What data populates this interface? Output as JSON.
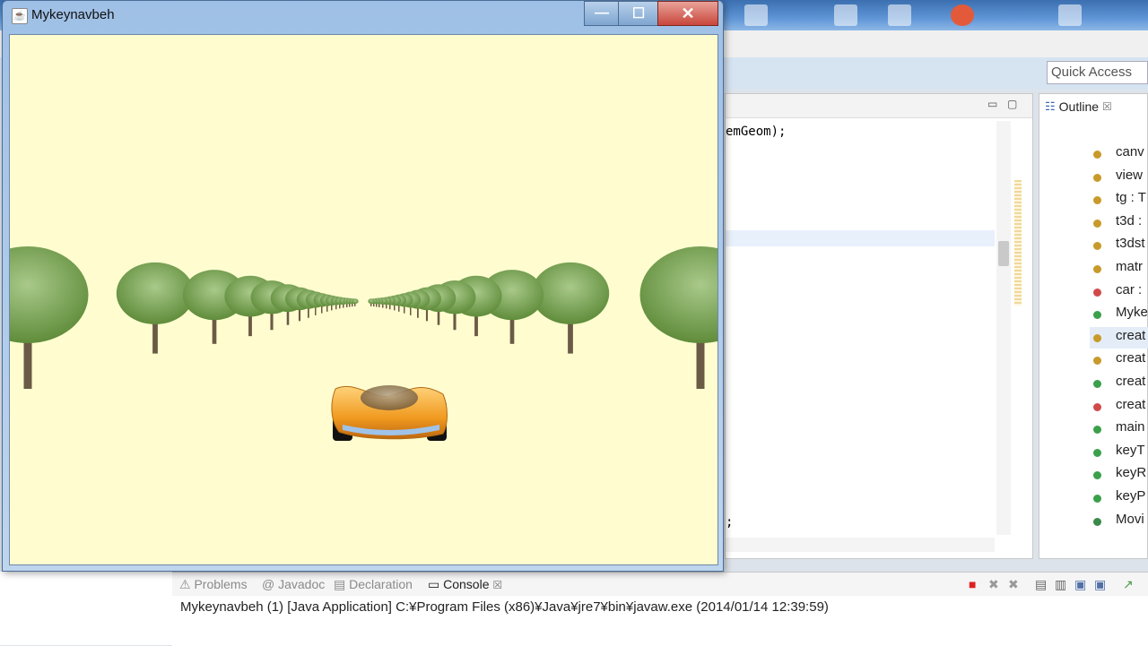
{
  "app_window": {
    "title": "Mykeynavbeh",
    "controls": {
      "minimize": "—",
      "maximize": "☐",
      "close": "✕"
    }
  },
  "eclipse": {
    "quick_access": "Quick Access",
    "editor": {
      "code_top": "emGeom);",
      "code_bottom": ";"
    },
    "outline": {
      "tab_label": "Outline",
      "tab_close": "☒",
      "items": [
        {
          "label": "canv",
          "icon_color": "#c89a2a"
        },
        {
          "label": "view",
          "icon_color": "#c89a2a"
        },
        {
          "label": "tg : T",
          "icon_color": "#c89a2a"
        },
        {
          "label": "t3d :",
          "icon_color": "#c89a2a"
        },
        {
          "label": "t3dst",
          "icon_color": "#c89a2a"
        },
        {
          "label": "matr",
          "icon_color": "#c89a2a"
        },
        {
          "label": "car :",
          "icon_color": "#d04a4a"
        },
        {
          "label": "Myke",
          "icon_color": "#3aa04a"
        },
        {
          "label": "creat",
          "icon_color": "#c89a2a"
        },
        {
          "label": "creat",
          "icon_color": "#c89a2a"
        },
        {
          "label": "creat",
          "icon_color": "#3aa04a"
        },
        {
          "label": "creat",
          "icon_color": "#d04a4a"
        },
        {
          "label": "main",
          "icon_color": "#3aa04a"
        },
        {
          "label": "keyT",
          "icon_color": "#3aa04a"
        },
        {
          "label": "keyR",
          "icon_color": "#3aa04a"
        },
        {
          "label": "keyP",
          "icon_color": "#3aa04a"
        },
        {
          "label": "Movi",
          "icon_color": "#3a8a4a"
        }
      ]
    },
    "bottom_tabs": [
      {
        "label": "Problems",
        "active": false
      },
      {
        "label": "Javadoc",
        "active": false
      },
      {
        "label": "Declaration",
        "active": false
      },
      {
        "label": "Console",
        "active": true
      }
    ],
    "console_line": "Mykeynavbeh (1) [Java Application] C:¥Program Files (x86)¥Java¥jre7¥bin¥javaw.exe (2014/01/14 12:39:59)"
  },
  "scene": {
    "background": "#fffdd0",
    "car_color": "#f0a030"
  }
}
